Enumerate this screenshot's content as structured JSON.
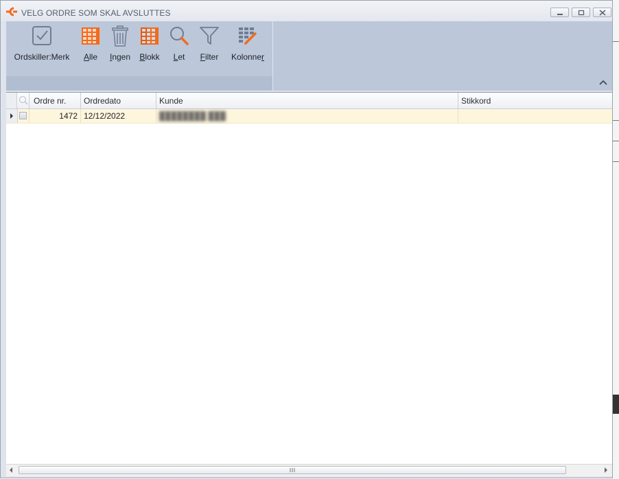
{
  "window": {
    "title": "VELG ORDRE SOM SKAL AVSLUTTES",
    "minimize_icon": "minimize-icon",
    "restore_icon": "restore-icon",
    "close_icon": "close-icon"
  },
  "ribbon": {
    "buttons": [
      {
        "label": "Ordskiller:Merk",
        "underline": "",
        "rest": "Ordskiller:Merk",
        "icon": "checkbox-check-icon"
      },
      {
        "label": "Alle",
        "underline": "A",
        "rest": "lle",
        "icon": "grid-orange-icon"
      },
      {
        "label": "Ingen",
        "underline": "I",
        "rest": "ngen",
        "icon": "trash-icon"
      },
      {
        "label": "Blokk",
        "underline": "B",
        "rest": "lokk",
        "icon": "grid-block-icon"
      },
      {
        "label": "Let",
        "underline": "L",
        "rest": "et",
        "icon": "search-icon"
      },
      {
        "label": "Filter",
        "underline": "F",
        "rest": "ilter",
        "icon": "filter-icon"
      },
      {
        "label": "Kolonner",
        "pre": "Kolonne",
        "underline": "r",
        "rest": "",
        "icon": "columns-edit-icon"
      }
    ],
    "collapse_icon": "chevron-up-icon"
  },
  "grid": {
    "columns": [
      "Ordre nr.",
      "Ordredato",
      "Kunde",
      "Stikkord"
    ],
    "rows": [
      {
        "ordre_nr": "1472",
        "ordredato": "12/12/2022",
        "kunde": "████████ ███",
        "stikkord": ""
      }
    ]
  },
  "colors": {
    "accent_orange": "#f26b1d",
    "ribbon_bg": "#bcc7d9",
    "selected_row": "#fef5dd"
  }
}
